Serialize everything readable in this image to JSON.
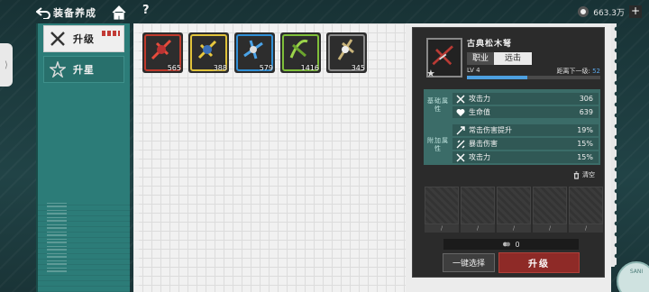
{
  "header": {
    "back_label": "装备养成",
    "currency_value": "663.3万",
    "help_label": "?",
    "plus_label": "+"
  },
  "tabs": [
    {
      "label": "升级",
      "active": true
    },
    {
      "label": "升星",
      "active": false
    }
  ],
  "items": [
    {
      "count": "565",
      "color": "#c0392b",
      "icon": "red-weapon-icon"
    },
    {
      "count": "388",
      "color": "#e0c23a",
      "icon": "gold-weapon-icon"
    },
    {
      "count": "579",
      "color": "#2f8fd6",
      "icon": "blue-weapon-icon"
    },
    {
      "count": "1416",
      "color": "#7fbf3a",
      "icon": "green-weapon-icon"
    },
    {
      "count": "345",
      "color": "#8a8a8a",
      "icon": "gray-weapon-icon"
    }
  ],
  "detail": {
    "weapon_name": "古典松木弩",
    "job_label": "职业",
    "job_value": "远击",
    "level": "LV 4",
    "next_label": "距离下一级:",
    "next_value": "52",
    "progress": 0.45,
    "base_group_label": "基础属性",
    "extra_group_label": "附加属性",
    "base_stats": [
      {
        "name": "攻击力",
        "value": "306",
        "icon": "swords-icon"
      },
      {
        "name": "生命值",
        "value": "639",
        "icon": "heart-icon"
      }
    ],
    "extra_stats": [
      {
        "name": "常击伤害提升",
        "value": "19%",
        "icon": "arrow-icon"
      },
      {
        "name": "暴击伤害",
        "value": "15%",
        "icon": "crit-icon"
      },
      {
        "name": "攻击力",
        "value": "15%",
        "icon": "swords-icon"
      }
    ],
    "clear_label": "清空",
    "cost_value": "0",
    "oneclick_label": "一键选择",
    "upgrade_label": "升级"
  }
}
